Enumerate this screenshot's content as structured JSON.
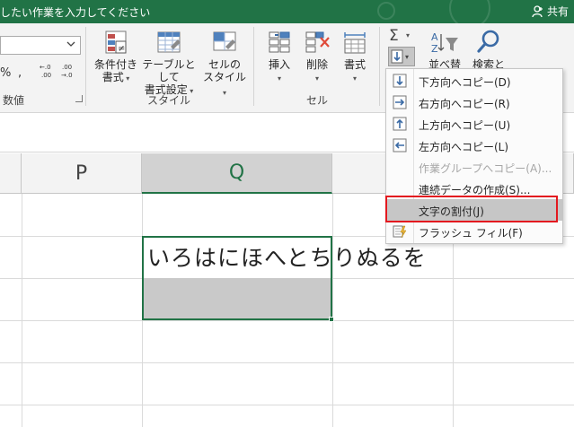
{
  "titlebar": {
    "text": "したい作業を入力してください",
    "share_label": "共有",
    "bg_color": "#217346"
  },
  "ribbon": {
    "number_group_label": "数値",
    "number_percent": "%",
    "number_comma": ",",
    "dec_increase": ".0←\n.00",
    "dec_decrease": ".00\n→.0",
    "style_group_label": "スタイル",
    "cond_format_label": "条件付き\n書式",
    "format_table_label": "テーブルとして\n書式設定",
    "cell_style_label": "セルの\nスタイル",
    "cells_group_label": "セル",
    "insert_label": "挿入",
    "delete_label": "削除",
    "format_label": "書式",
    "sort_filter_label": "並べ替えと",
    "find_select_label": "検索と"
  },
  "grid": {
    "col_p": "P",
    "col_q": "Q",
    "cell_q_text": "いろはにほへとちりぬるを",
    "accent": "#217346"
  },
  "fill_menu": {
    "items": [
      {
        "label": "下方向へコピー(D)",
        "icon": "fill-down-icon",
        "enabled": true
      },
      {
        "label": "右方向へコピー(R)",
        "icon": "fill-right-icon",
        "enabled": true
      },
      {
        "label": "上方向へコピー(U)",
        "icon": "fill-up-icon",
        "enabled": true
      },
      {
        "label": "左方向へコピー(L)",
        "icon": "fill-left-icon",
        "enabled": true
      },
      {
        "label": "作業グループへコピー(A)...",
        "icon": "",
        "enabled": false
      },
      {
        "label": "連続データの作成(S)...",
        "icon": "",
        "enabled": true
      },
      {
        "label": "文字の割付(J)",
        "icon": "",
        "enabled": true,
        "highlighted": true
      },
      {
        "label": "フラッシュ フィル(F)",
        "icon": "flash-fill-icon",
        "enabled": true
      }
    ],
    "highlight_color": "#c6c6c6",
    "annotation_color": "#e3191f"
  }
}
